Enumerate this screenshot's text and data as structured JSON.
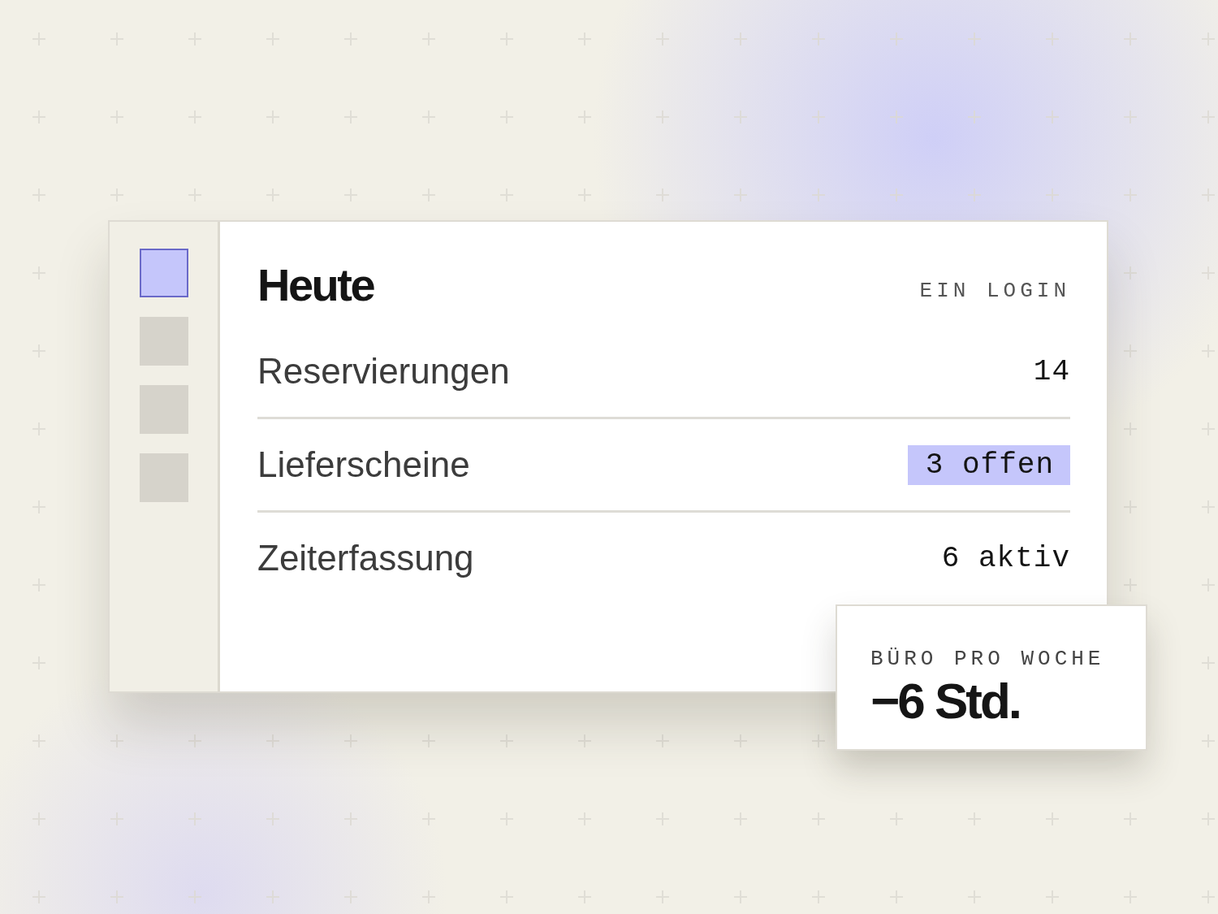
{
  "sidebar": {
    "items": [
      {
        "selected": true
      },
      {
        "selected": false
      },
      {
        "selected": false
      },
      {
        "selected": false
      }
    ]
  },
  "panel": {
    "title": "Heute",
    "tag": "EIN LOGIN",
    "rows": [
      {
        "label": "Reservierungen",
        "value": "14",
        "highlighted": false
      },
      {
        "label": "Lieferscheine",
        "value": "3 offen",
        "highlighted": true
      },
      {
        "label": "Zeiterfassung",
        "value": "6 aktiv",
        "highlighted": false
      }
    ]
  },
  "stat_card": {
    "label": "BÜRO PRO WOCHE",
    "value": "−6 Std."
  }
}
